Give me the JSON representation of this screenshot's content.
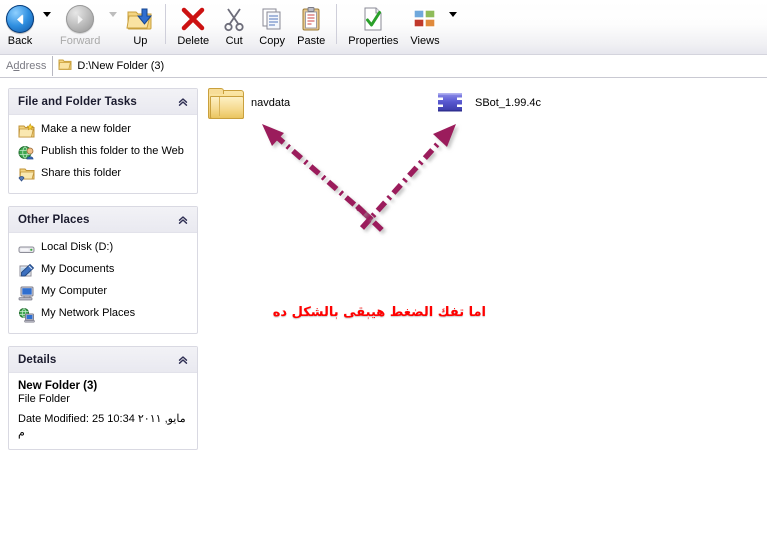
{
  "toolbar": {
    "buttons": [
      {
        "label": "Back",
        "icon": "back-arrow-icon",
        "enabled": true,
        "has_dropdown": true
      },
      {
        "label": "Forward",
        "icon": "forward-arrow-icon",
        "enabled": false,
        "has_dropdown": true
      },
      {
        "label": "Up",
        "icon": "up-folder-icon",
        "enabled": true,
        "has_dropdown": false
      },
      {
        "label": "Delete",
        "icon": "red-x-icon",
        "enabled": true,
        "has_dropdown": false
      },
      {
        "label": "Cut",
        "icon": "scissors-icon",
        "enabled": true,
        "has_dropdown": false
      },
      {
        "label": "Copy",
        "icon": "copy-pages-icon",
        "enabled": true,
        "has_dropdown": false
      },
      {
        "label": "Paste",
        "icon": "clipboard-icon",
        "enabled": true,
        "has_dropdown": false
      },
      {
        "label": "Properties",
        "icon": "checkmark-page-icon",
        "enabled": true,
        "has_dropdown": false
      },
      {
        "label": "Views",
        "icon": "views-grid-icon",
        "enabled": true,
        "has_dropdown": true
      }
    ]
  },
  "address": {
    "label": "Address",
    "label_accel": "d",
    "value": "D:\\New Folder (3)",
    "icon": "folder-icon"
  },
  "sidebar": {
    "panels": [
      {
        "title": "File and Folder Tasks",
        "collapse_icon": "double-chevron-up-icon",
        "items": [
          {
            "label": "Make a new folder",
            "icon": "new-folder-icon"
          },
          {
            "label": "Publish this folder to the Web",
            "icon": "publish-web-icon"
          },
          {
            "label": "Share this folder",
            "icon": "share-folder-icon"
          }
        ]
      },
      {
        "title": "Other Places",
        "collapse_icon": "double-chevron-up-icon",
        "items": [
          {
            "label": "Local Disk (D:)",
            "icon": "hard-disk-icon"
          },
          {
            "label": "My Documents",
            "icon": "my-documents-icon"
          },
          {
            "label": "My Computer",
            "icon": "my-computer-icon"
          },
          {
            "label": "My Network Places",
            "icon": "network-places-icon"
          }
        ]
      }
    ],
    "details": {
      "title": "Details",
      "collapse_icon": "double-chevron-up-icon",
      "name": "New Folder (3)",
      "type": "File Folder",
      "date_modified": "Date Modified: 25 مايو, ٢٠١١ 10:34 م"
    }
  },
  "files": [
    {
      "name": "navdata",
      "icon": "folder-icon",
      "type": "folder"
    },
    {
      "name": "SBot_1.99.4c",
      "icon": "sbot-s-logo-icon",
      "type": "application"
    }
  ],
  "annotations": {
    "text": "اما تفك الضغط هيبقى بالشكل ده",
    "text_color": "#ff0000",
    "arrow_color": "#9b1b5c",
    "arrows": [
      {
        "name": "arrow-to-navdata",
        "points_at": "navdata"
      },
      {
        "name": "arrow-to-sbot",
        "points_at": "SBot_1.99.4c"
      }
    ]
  }
}
